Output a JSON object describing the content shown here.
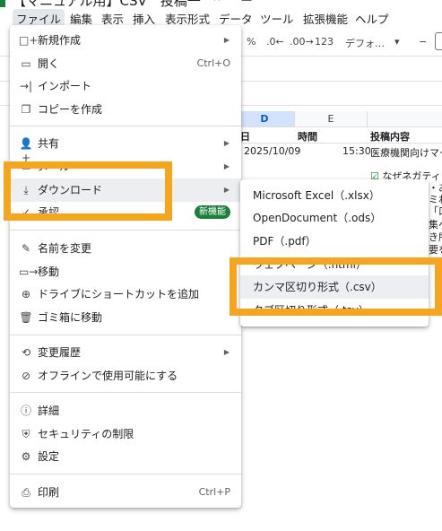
{
  "title": "【マニュアル用】CSV　投稿一",
  "menubar": [
    "ファイル",
    "編集",
    "表示",
    "挿入",
    "表示形式",
    "データ",
    "ツール",
    "拡張機能",
    "ヘルプ"
  ],
  "toolbar": {
    "percent": "%",
    "dec_dec": ".0←",
    "dec_inc": ".00→",
    "num_fmt": "123",
    "font": "デフォ…",
    "dropdown": "▾",
    "minus": "−"
  },
  "sheet": {
    "col_d": "D",
    "col_e": "E",
    "headers": {
      "date": "日",
      "time": "時間",
      "content": "投稿内容"
    },
    "row1": {
      "date": "2025/10/09",
      "time": "15:30",
      "content": "医療機関向けマー"
    },
    "snippets": [
      "なぜネガティブ",
      "・あ",
      "ミれ",
      "「口",
      "集へ",
      "き所",
      "要を"
    ]
  },
  "file_menu": {
    "items": [
      {
        "icon": "□+",
        "label": "新規作成",
        "arrow": true
      },
      {
        "icon": "▭",
        "label": "開く",
        "shortcut": "Ctrl+O"
      },
      {
        "icon": "→|",
        "label": "インポート"
      },
      {
        "icon": "❐",
        "label": "コピーを作成"
      },
      {
        "icon": "👤+",
        "label": "共有",
        "arrow": true
      },
      {
        "icon": "✉",
        "label": "メール",
        "arrow": true
      },
      {
        "icon": "⤓",
        "label": "ダウンロード",
        "arrow": true
      },
      {
        "icon": "✓",
        "label": "承認",
        "badge": "新機能"
      },
      {
        "icon": "✎",
        "label": "名前を変更"
      },
      {
        "icon": "▭→",
        "label": "移動"
      },
      {
        "icon": "⊕",
        "label": "ドライブにショートカットを追加"
      },
      {
        "icon": "🗑",
        "label": "ゴミ箱に移動"
      },
      {
        "icon": "⟲",
        "label": "変更履歴",
        "arrow": true
      },
      {
        "icon": "⊘",
        "label": "オフラインで使用可能にする"
      },
      {
        "icon": "ⓘ",
        "label": "詳細"
      },
      {
        "icon": "⛨",
        "label": "セキュリティの制限"
      },
      {
        "icon": "⚙",
        "label": "設定"
      },
      {
        "icon": "⎙",
        "label": "印刷",
        "shortcut": "Ctrl+P"
      }
    ]
  },
  "download_menu": {
    "items": [
      {
        "label": "Microsoft Excel（.xlsx）"
      },
      {
        "label": "OpenDocument（.ods）"
      },
      {
        "label": "PDF（.pdf）"
      },
      {
        "label": "ウェブページ（.html）"
      },
      {
        "label": "カンマ区切り形式（.csv）"
      },
      {
        "label": "タブ区切り形式（.tsv）"
      }
    ]
  },
  "colors": {
    "highlight_box": "#f7a51c",
    "badge": "#188038",
    "selected_col": "#d3e3fd"
  }
}
